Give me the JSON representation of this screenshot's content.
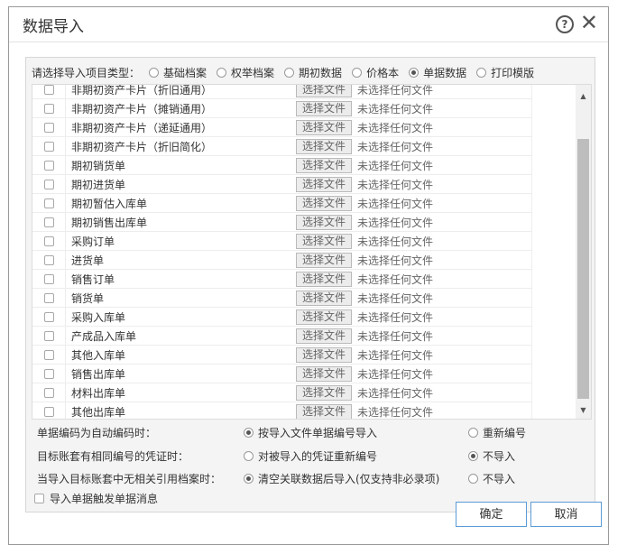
{
  "dialog": {
    "title": "数据导入"
  },
  "type_selector": {
    "label": "请选择导入项目类型：",
    "options": [
      {
        "label": "基础档案",
        "selected": false
      },
      {
        "label": "权举档案",
        "selected": false
      },
      {
        "label": "期初数据",
        "selected": false
      },
      {
        "label": "价格本",
        "selected": false
      },
      {
        "label": "单据数据",
        "selected": true
      },
      {
        "label": "打印模版",
        "selected": false
      }
    ]
  },
  "file_button_label": "选择文件",
  "file_status": "未选择任何文件",
  "items": [
    "非期初资产卡片（折旧通用）",
    "非期初资产卡片（摊销通用）",
    "非期初资产卡片（递延通用）",
    "非期初资产卡片（折旧简化）",
    "期初销货单",
    "期初进货单",
    "期初暂估入库单",
    "期初销售出库单",
    "采购订单",
    "进货单",
    "销售订单",
    "销货单",
    "采购入库单",
    "产成品入库单",
    "其他入库单",
    "销售出库单",
    "材料出库单",
    "其他出库单"
  ],
  "options": {
    "auto_code": {
      "label": "单据编码为自动编码时：",
      "a": "按导入文件单据编号导入",
      "a_selected": true,
      "b": "重新编号",
      "b_selected": false
    },
    "same_code": {
      "label": "目标账套有相同编号的凭证时：",
      "a": "对被导入的凭证重新编号",
      "a_selected": false,
      "b": "不导入",
      "b_selected": true
    },
    "no_ref": {
      "label": "当导入目标账套中无相关引用档案时：",
      "a": "清空关联数据后导入(仅支持非必录项)",
      "a_selected": true,
      "b": "不导入",
      "b_selected": false
    }
  },
  "trigger_message": {
    "label": "导入单据触发单据消息",
    "checked": false
  },
  "buttons": {
    "confirm": "确定",
    "cancel": "取消"
  }
}
